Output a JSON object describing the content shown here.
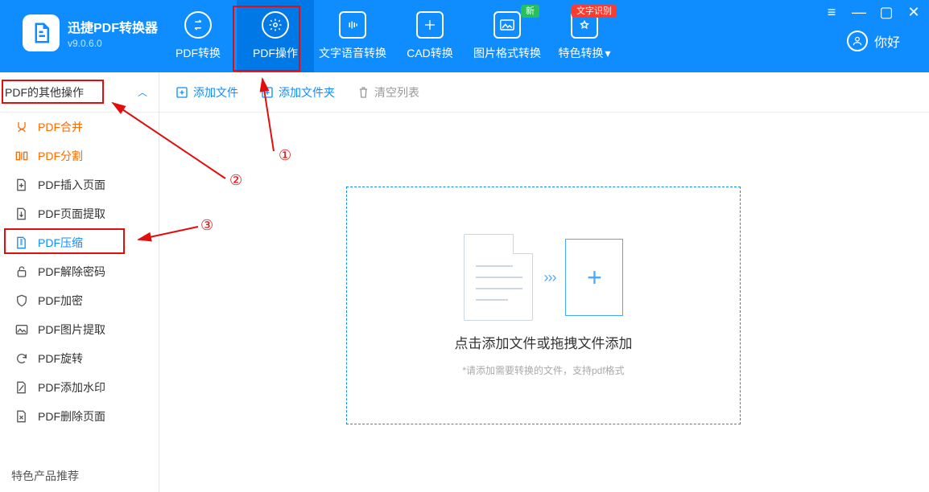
{
  "app": {
    "name": "迅捷PDF转换器",
    "version": "v9.0.6.0"
  },
  "tabs": [
    {
      "label": "PDF转换"
    },
    {
      "label": "PDF操作"
    },
    {
      "label": "文字语音转换"
    },
    {
      "label": "CAD转换"
    },
    {
      "label": "图片格式转换"
    },
    {
      "label": "特色转换",
      "badge_new": "新",
      "badge_ocr": "文字识别"
    }
  ],
  "user": {
    "greeting": "你好"
  },
  "sidebar": {
    "group_label": "PDF的其他操作",
    "items": [
      {
        "label": "PDF合并"
      },
      {
        "label": "PDF分割"
      },
      {
        "label": "PDF插入页面"
      },
      {
        "label": "PDF页面提取"
      },
      {
        "label": "PDF压缩"
      },
      {
        "label": "PDF解除密码"
      },
      {
        "label": "PDF加密"
      },
      {
        "label": "PDF图片提取"
      },
      {
        "label": "PDF旋转"
      },
      {
        "label": "PDF添加水印"
      },
      {
        "label": "PDF删除页面"
      }
    ],
    "footer": "特色产品推荐"
  },
  "toolbar": {
    "add_file": "添加文件",
    "add_folder": "添加文件夹",
    "clear_list": "清空列表"
  },
  "dropzone": {
    "title": "点击添加文件或拖拽文件添加",
    "subtitle": "*请添加需要转换的文件，支持pdf格式"
  },
  "annotations": {
    "n1": "①",
    "n2": "②",
    "n3": "③"
  }
}
